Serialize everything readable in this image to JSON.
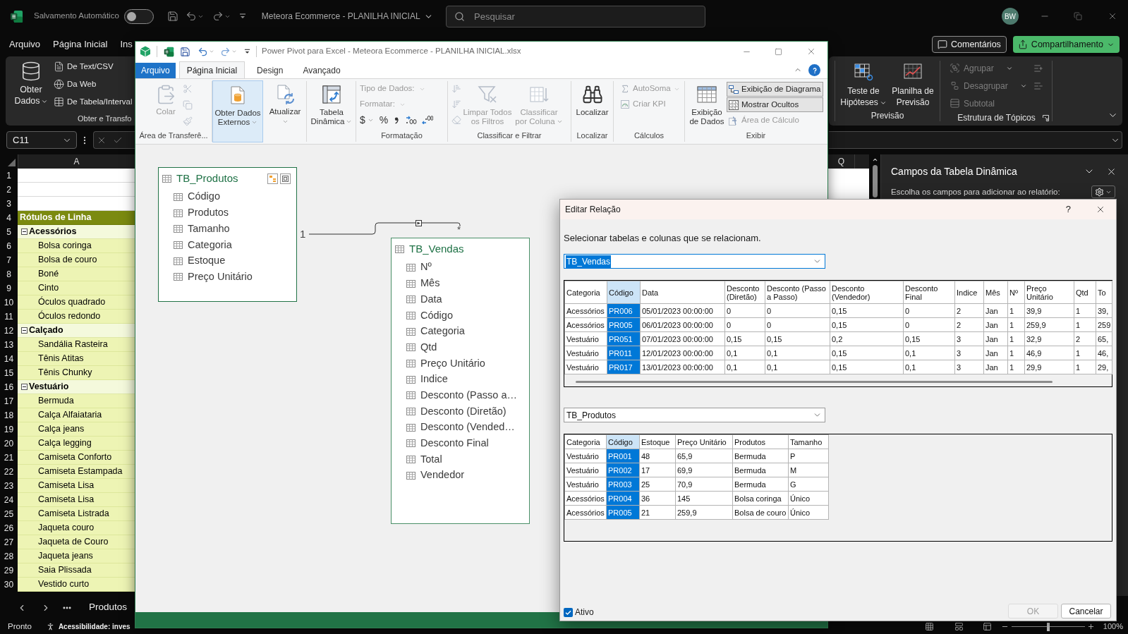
{
  "excel": {
    "title_bar": {
      "autosave_label": "Salvamento Automático",
      "autosave_on": false,
      "document_title": "Meteora Ecommerce - PLANILHA INICIAL",
      "search_placeholder": "Pesquisar",
      "avatar_initials": "BW"
    },
    "menu_tabs": [
      "Arquivo",
      "Página Inicial",
      "Ins"
    ],
    "header_buttons": {
      "comments": "Comentários",
      "share": "Compartilhamento"
    },
    "ribbon": {
      "get_data": "Obter Dados",
      "sources": [
        "De Text/CSV",
        "Da Web",
        "De Tabela/Interval"
      ],
      "get_data_group": "Obter e Transfo",
      "forecast": {
        "label": "Previsão",
        "buttons": [
          {
            "label": "Teste de Hipóteses",
            "dropdown": true
          },
          {
            "label": "Planilha de Previsão"
          }
        ]
      },
      "outline": {
        "label": "Estrutura de Tópicos",
        "items": [
          {
            "label": "Agrupar",
            "disabled": true,
            "dropdown": true
          },
          {
            "label": "Desagrupar",
            "disabled": true,
            "dropdown": true
          },
          {
            "label": "Subtotal",
            "disabled": true
          }
        ]
      }
    },
    "name_box": "C11",
    "sheet": {
      "column_headers": [
        "A",
        "Q"
      ],
      "row_numbers": [
        "1",
        "2",
        "3",
        "4",
        "5",
        "6",
        "7",
        "8",
        "9",
        "10",
        "11",
        "12",
        "13",
        "14",
        "15",
        "16",
        "17",
        "18",
        "19",
        "20",
        "21",
        "22",
        "23",
        "24",
        "25",
        "26",
        "27",
        "28",
        "29",
        "30"
      ],
      "pivot": {
        "header": "Rótulos de Linha",
        "groups": [
          {
            "label": "Acessórios",
            "expanded": true,
            "children": [
              "Bolsa coringa",
              "Bolsa de couro",
              "Boné",
              "Cinto",
              "Óculos quadrado",
              "Óculos redondo"
            ]
          },
          {
            "label": "Calçado",
            "expanded": true,
            "children": [
              "Sandália Rasteira",
              "Tênis Atitas",
              "Tênis Chunky"
            ]
          },
          {
            "label": "Vestuário",
            "expanded": true,
            "children": [
              "Bermuda",
              "Calça Alfaiataria",
              "Calça jeans",
              "Calça legging",
              "Camiseta Conforto",
              "Camiseta Estampada",
              "Camiseta Lisa",
              "Camiseta Lisa",
              "Camiseta Listrada",
              "Jaqueta couro",
              "Jaqueta de Couro",
              "Jaqueta jeans",
              "Saia Plissada",
              "Vestido curto"
            ]
          }
        ]
      },
      "tabs": [
        "Produtos"
      ]
    },
    "pivot_fields_pane": {
      "title": "Campos da Tabela Dinâmica",
      "subtitle": "Escolha os campos para adicionar ao relatório:"
    },
    "status_bar": {
      "ready": "Pronto",
      "accessibility": "Acessibilidade: inves",
      "zoom_slider": {
        "level": 0.5
      },
      "zoom": "100%"
    }
  },
  "power_pivot": {
    "title": "Power Pivot para Excel - Meteora Ecommerce - PLANILHA INICIAL.xlsx",
    "tabs": [
      {
        "label": "Arquivo",
        "kind": "file",
        "selected": false
      },
      {
        "label": "Página Inicial",
        "kind": "tab",
        "selected": true
      },
      {
        "label": "Design",
        "kind": "tab",
        "selected": false
      },
      {
        "label": "Avançado",
        "kind": "tab",
        "selected": false
      }
    ],
    "ribbon": {
      "clipboard": {
        "label": "Área de Transferê...",
        "paste": {
          "label": "Colar",
          "disabled": true
        }
      },
      "external_data": {
        "label": "Obter Dados Externos",
        "highlighted": true,
        "dropdown": true
      },
      "refresh": {
        "label": "Atualizar",
        "dropdown": true
      },
      "pivot_table": {
        "label": "Tabela Dinâmica",
        "dropdown": true
      },
      "formatting": {
        "label": "Formatação",
        "data_type": {
          "label": "Tipo de Dados:",
          "disabled": true
        },
        "format": {
          "label": "Formatar:",
          "disabled": true
        },
        "currency": "$",
        "percent": "%"
      },
      "sort_filter": {
        "label": "Classificar e Filtrar",
        "clear_filters": {
          "label": "Limpar Todos os Filtros",
          "disabled": true
        },
        "sort_by_column": {
          "label": "Classificar por Coluna",
          "disabled": true,
          "dropdown": true
        }
      },
      "find": {
        "label": "Localizar",
        "button": "Localizar"
      },
      "calculations": {
        "label": "Cálculos",
        "autosum": {
          "label": "AutoSoma",
          "disabled": true,
          "dropdown": true
        },
        "kpi": {
          "label": "Criar KPI",
          "disabled": true
        }
      },
      "view": {
        "label": "Exibir",
        "data_view": "Exibição de Dados",
        "options": [
          {
            "label": "Exibição de Diagrama",
            "selected": true,
            "disabled": false
          },
          {
            "label": "Mostrar Ocultos",
            "selected": true,
            "disabled": false
          },
          {
            "label": "Área de Cálculo",
            "selected": false,
            "disabled": true
          }
        ]
      }
    },
    "diagram": {
      "tables": [
        {
          "name": "TB_Produtos",
          "selected": true,
          "fields": [
            "Código",
            "Produtos",
            "Tamanho",
            "Categoria",
            "Estoque",
            "Preço Unitário"
          ]
        },
        {
          "name": "TB_Vendas",
          "selected": false,
          "fields": [
            "Nº",
            "Mês",
            "Data",
            "Código",
            "Categoria",
            "Qtd",
            "Preço Unitário",
            "Indice",
            "Desconto (Passo a…",
            "Desconto (Diretão)",
            "Desconto (Vended…",
            "Desconto Final",
            "Total",
            "Vendedor"
          ]
        }
      ],
      "relationship": {
        "one_label": "1",
        "many_label": "*"
      }
    }
  },
  "dialog": {
    "title": "Editar Relação",
    "help": "?",
    "instruction": "Selecionar tabelas e colunas que se relacionam.",
    "tables": [
      {
        "value": "TB_Vendas",
        "focused": true,
        "columns": [
          {
            "label": "Categoria",
            "selected": false
          },
          {
            "label": "Código",
            "selected": true
          },
          {
            "label": "Data",
            "selected": false
          },
          {
            "label": "Desconto (Diretão)",
            "selected": false
          },
          {
            "label": "Desconto (Passo a Passo)",
            "selected": false
          },
          {
            "label": "Desconto (Vendedor)",
            "selected": false
          },
          {
            "label": "Desconto Final",
            "selected": false
          },
          {
            "label": "Indice",
            "selected": false
          },
          {
            "label": "Mês",
            "selected": false
          },
          {
            "label": "Nº",
            "selected": false
          },
          {
            "label": "Preço Unitário",
            "selected": false
          },
          {
            "label": "Qtd",
            "selected": false
          },
          {
            "label": "To",
            "selected": false
          }
        ],
        "rows": [
          [
            "Acessórios",
            "PR006",
            "05/01/2023 00:00:00",
            "0",
            "0",
            "0,15",
            "0",
            "2",
            "Jan",
            "1",
            "39,9",
            "1",
            "39,"
          ],
          [
            "Acessórios",
            "PR005",
            "06/01/2023 00:00:00",
            "0",
            "0",
            "0,15",
            "0",
            "2",
            "Jan",
            "1",
            "259,9",
            "1",
            "259"
          ],
          [
            "Vestuário",
            "PR051",
            "07/01/2023 00:00:00",
            "0,15",
            "0,15",
            "0,2",
            "0,15",
            "3",
            "Jan",
            "1",
            "32,9",
            "2",
            "65,"
          ],
          [
            "Vestuário",
            "PR011",
            "12/01/2023 00:00:00",
            "0,1",
            "0,1",
            "0,15",
            "0,1",
            "3",
            "Jan",
            "1",
            "46,9",
            "1",
            "46,"
          ],
          [
            "Vestuário",
            "PR017",
            "13/01/2023 00:00:00",
            "0,1",
            "0,1",
            "0,15",
            "0,1",
            "3",
            "Jan",
            "1",
            "29,9",
            "1",
            "29,"
          ]
        ]
      },
      {
        "value": "TB_Produtos",
        "focused": false,
        "columns": [
          {
            "label": "Categoria",
            "selected": false
          },
          {
            "label": "Código",
            "selected": true
          },
          {
            "label": "Estoque",
            "selected": false
          },
          {
            "label": "Preço Unitário",
            "selected": false
          },
          {
            "label": "Produtos",
            "selected": false
          },
          {
            "label": "Tamanho",
            "selected": false
          }
        ],
        "rows": [
          [
            "Vestuário",
            "PR001",
            "48",
            "65,9",
            "Bermuda",
            "P"
          ],
          [
            "Vestuário",
            "PR002",
            "17",
            "69,9",
            "Bermuda",
            "M"
          ],
          [
            "Vestuário",
            "PR003",
            "25",
            "70,9",
            "Bermuda",
            "G"
          ],
          [
            "Acessórios",
            "PR004",
            "36",
            "145",
            "Bolsa coringa",
            "Único"
          ],
          [
            "Acessórios",
            "PR005",
            "21",
            "259,9",
            "Bolsa de couro",
            "Único"
          ]
        ]
      }
    ],
    "active": {
      "label": "Ativo",
      "checked": true
    },
    "buttons": [
      {
        "label": "OK",
        "disabled": true
      },
      {
        "label": "Cancelar",
        "disabled": false
      }
    ]
  }
}
